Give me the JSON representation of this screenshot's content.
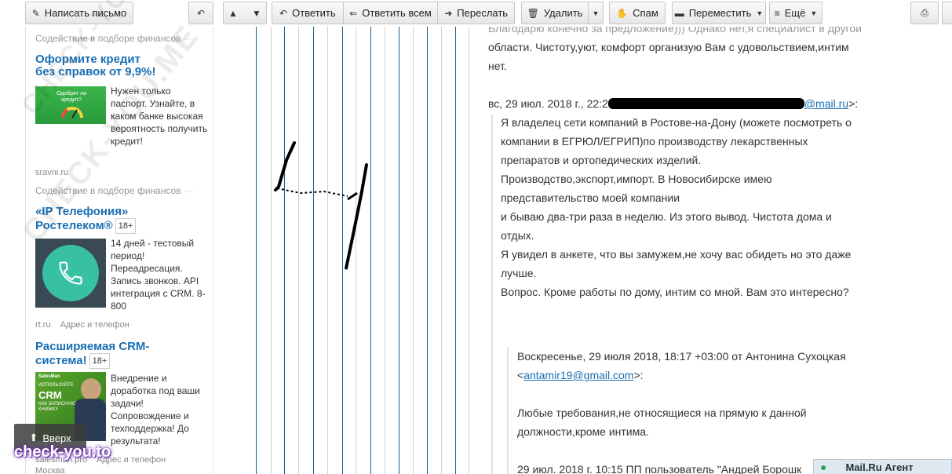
{
  "toolbar": {
    "compose": "Написать письмо",
    "reply": "Ответить",
    "reply_all": "Ответить всем",
    "forward": "Переслать",
    "delete": "Удалить",
    "spam": "Спам",
    "move": "Переместить",
    "more": "Ещё"
  },
  "ads": [
    {
      "label": "Содействие в подборе финансов",
      "title_line1": "Оформите кредит",
      "title_line2": "без справок от 9,9%!",
      "image_caption": "Одобрят ли кредит?",
      "text": "Нужен только паспорт. Узнайте, в каком банке высокая вероятность получить кредит!",
      "source": "sravni.ru"
    },
    {
      "label": "Содействие в подборе финансов",
      "title_line1": "«IP Телефония»",
      "title_line2": "Ростелеком®",
      "age": "18+",
      "text": "14 дней - тестовый период! Переадресация. Запись звонков. API интеграция с CRM. 8-800",
      "source": "rt.ru",
      "source_extra": "Адрес и телефон"
    },
    {
      "title_line1": "Расширяемая CRM-",
      "title_line2": "система!",
      "age": "18+",
      "image_caption": "SalesMan",
      "image_line1": "ИСПОЛЬЗУЙТЕ",
      "image_line2": "CRM",
      "image_line3": "КАК ЗАПИСНУЮ",
      "image_line4": "КНИЖКУ",
      "text": "Внедрение и доработка под ваши задачи! Сопровождение и техподдержка! До результата!",
      "source": "salesman.pro",
      "source_extra": "Адрес и телефон",
      "city": "Москва"
    }
  ],
  "up_button": "Вверх",
  "watermark_site": "check-you.to",
  "watermark": "CHECK-YOU.ME",
  "message": {
    "line0": "Благодарю конечно за предложение))) Однако нет,я специалист в другой",
    "line1": "области. Чистоту,уют, комфорт организую Вам  с удовольствием,интим",
    "line2": "нет.",
    "quote_header_prefix": "вс, 29 июл. 2018 г., 22:2",
    "quote_header_email": "@mail.ru",
    "quote_header_suffix": ">:",
    "q1": "Я владелец сети компаний в Ростове-на-Дону (можете посмотреть о",
    "q2": "компании в ЕГРЮЛ/ЕГРИП)по производству лекарственных",
    "q3": "препаратов и ортопедических изделий.",
    "q4": "Производство,экспорт,импорт. В Новосибирске имею",
    "q5": "представительство моей компании",
    "q6": "и бываю два-три раза в неделю. Из этого вывод. Чистота дома и",
    "q7": "отдых.",
    "q8": "Я увидел в анкете, что вы замужем,не хочу вас обидеть но это даже",
    "q9": "лучше.",
    "q10": "Вопрос. Кроме работы по дому, интим со мной. Вам это интересно?",
    "n1": "Воскресенье, 29 июля 2018, 18:17 +03:00 от Антонина Сухоцкая",
    "n2_prefix": "<",
    "n2_email": "antamir19@gmail.com",
    "n2_suffix": ">:",
    "n3": "Любые требования,не относящиеся на прямую к данной",
    "n4": "должности,кроме интима.",
    "n5": "29 июл. 2018 г. 10:15 ПП пользователь \"Андрей Борошк"
  },
  "agent": "Mail.Ru Агент"
}
